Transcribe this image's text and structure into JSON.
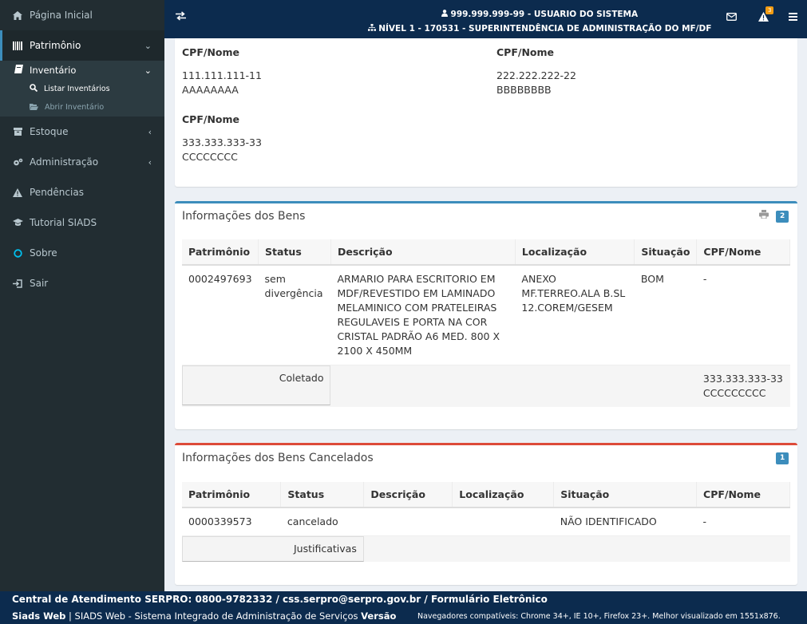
{
  "sidebar": {
    "home": "Página Inicial",
    "patrimonio": "Patrimônio",
    "inventario": "Inventário",
    "listar": "Listar Inventários",
    "abrir": "Abrir Inventário",
    "estoque": "Estoque",
    "administracao": "Administração",
    "pendencias": "Pendências",
    "tutorial": "Tutorial SIADS",
    "sobre": "Sobre",
    "sair": "Sair"
  },
  "header": {
    "user": "999.999.999-99 - USUARIO DO SISTEMA",
    "level": "NÍVEL 1 - 170531 - SUPERINTENDÊNCIA DE ADMINISTRAÇÃO DO MF/DF",
    "alerts": "3",
    "icons": [
      "exchange-icon",
      "envelope-icon",
      "warning-icon",
      "menu-icon"
    ]
  },
  "responsaveis": {
    "label": "CPF/Nome",
    "people": [
      {
        "cpf": "111.111.111-11",
        "nome": "AAAAAAAA"
      },
      {
        "cpf": "222.222.222-22",
        "nome": "BBBBBBBB"
      },
      {
        "cpf": "333.333.333-33",
        "nome": "CCCCCCCC"
      }
    ]
  },
  "bens": {
    "title": "Informações dos Bens",
    "count": "2",
    "headers": [
      "Patrimônio",
      "Status",
      "Descrição",
      "Localização",
      "Situação",
      "CPF/Nome"
    ],
    "row": {
      "patrimonio": "0002497693",
      "status": "sem divergência",
      "descricao": "ARMARIO PARA ESCRITORIO EM MDF/REVESTIDO EM LAMINADO MELAMINICO COM PRATELEIRAS REGULAVEIS E PORTA NA COR CRISTAL PADRÃO A6 MED. 800 X 2100 X 450MM",
      "localizacao": "ANEXO MF.TERREO.ALA B.SL 12.COREM/GESEM",
      "situacao": "BOM",
      "cpf": "-"
    },
    "coletado_label": "Coletado",
    "coletado_cpf": "333.333.333-33",
    "coletado_nome": "CCCCCCCCC"
  },
  "cancelados": {
    "title": "Informações dos Bens Cancelados",
    "count": "1",
    "headers": [
      "Patrimônio",
      "Status",
      "Descrição",
      "Localização",
      "Situação",
      "CPF/Nome"
    ],
    "row": {
      "patrimonio": "0000339573",
      "status": "cancelado",
      "descricao": "",
      "localizacao": "",
      "situacao": "NÃO IDENTIFICADO",
      "cpf": "-"
    },
    "justificativas_label": "Justificativas"
  },
  "footer": {
    "line1": "Central de Atendimento SERPRO: 0800-9782332 / css.serpro@serpro.gov.br / Formulário Eletrônico",
    "brand": "Siads Web",
    "desc": " | SIADS Web - Sistema Integrado de Administração de Serviços ",
    "versao": "Versão",
    "browsers": "Navegadores compatíveis: Chrome 34+, IE 10+, Firefox 23+. Melhor visualizado em 1551x876."
  },
  "colors": {
    "sidebar_bg": "#222d32",
    "header_bg": "#0c2b4e",
    "accent_blue": "#3c8dbc",
    "accent_red": "#dd4b39",
    "badge_orange": "#f39c12"
  }
}
